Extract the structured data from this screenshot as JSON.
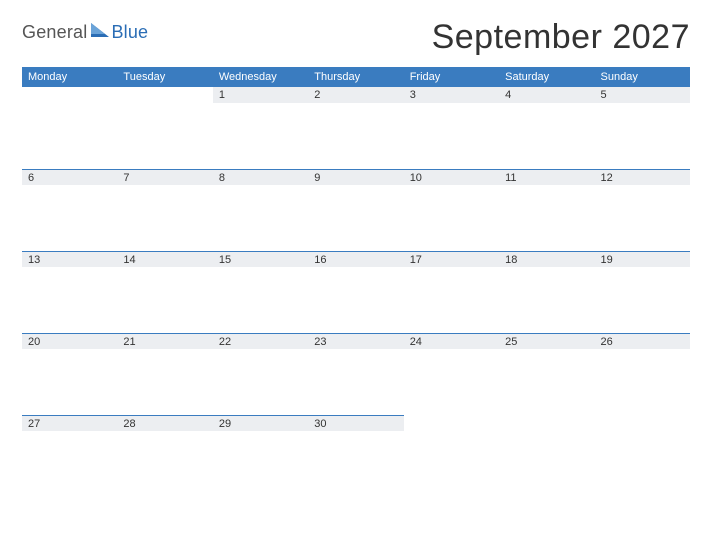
{
  "logo": {
    "text1": "General",
    "text2": "Blue"
  },
  "title": "September 2027",
  "day_headers": [
    "Monday",
    "Tuesday",
    "Wednesday",
    "Thursday",
    "Friday",
    "Saturday",
    "Sunday"
  ],
  "weeks": [
    [
      "",
      "",
      "1",
      "2",
      "3",
      "4",
      "5"
    ],
    [
      "6",
      "7",
      "8",
      "9",
      "10",
      "11",
      "12"
    ],
    [
      "13",
      "14",
      "15",
      "16",
      "17",
      "18",
      "19"
    ],
    [
      "20",
      "21",
      "22",
      "23",
      "24",
      "25",
      "26"
    ],
    [
      "27",
      "28",
      "29",
      "30",
      "",
      "",
      ""
    ]
  ]
}
